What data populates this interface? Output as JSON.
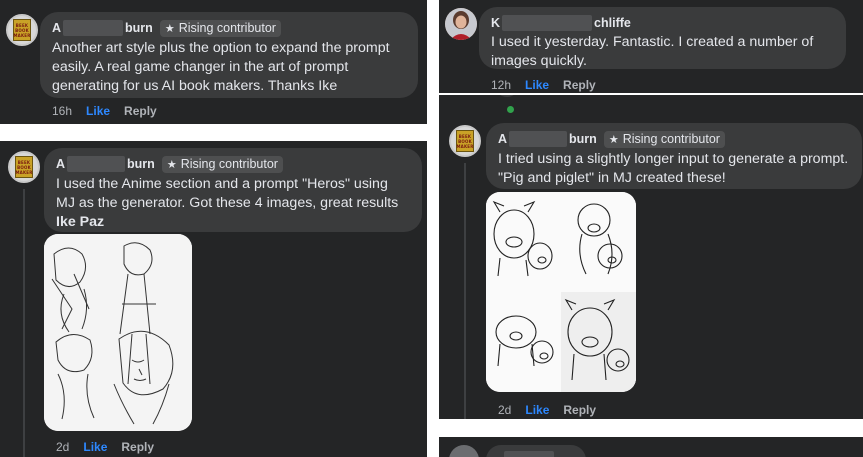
{
  "comments": [
    {
      "author_prefix": "A",
      "author_suffix": "burn",
      "badge": "Rising contributor",
      "text": "Another art style plus the option to expand the prompt easily. A real game changer in the art of prompt generating for us AI book makers. Thanks Ike",
      "time": "16h",
      "like": "Like",
      "reply": "Reply"
    },
    {
      "author_prefix": "K",
      "author_suffix": "chliffe",
      "text": "I used it yesterday. Fantastic. I created a number of images quickly.",
      "time": "12h",
      "like": "Like",
      "reply": "Reply"
    },
    {
      "author_prefix": "A",
      "author_suffix": "burn",
      "badge": "Rising contributor",
      "text": "I used the Anime section and a prompt \"Heros\" using MJ as the generator. Got these 4 images, great results ",
      "text_bold": "Ike Paz",
      "time": "2d",
      "like": "Like",
      "reply": "Reply"
    },
    {
      "author_prefix": "A",
      "author_suffix": "burn",
      "badge": "Rising contributor",
      "text": "I tried using a slightly longer input to generate a prompt. \"Pig and piglet\" in MJ created these!",
      "time": "2d",
      "like": "Like",
      "reply": "Reply"
    }
  ],
  "avatar_book_text": [
    "BEEK",
    "BOOK",
    "MAKER"
  ],
  "colors": {
    "panel_bg": "#242526",
    "bubble_bg": "#3a3b3c",
    "text": "#e4e6eb",
    "meta": "#b0b3b8",
    "like_blue": "#2d88ff",
    "online_green": "#31a24c"
  }
}
